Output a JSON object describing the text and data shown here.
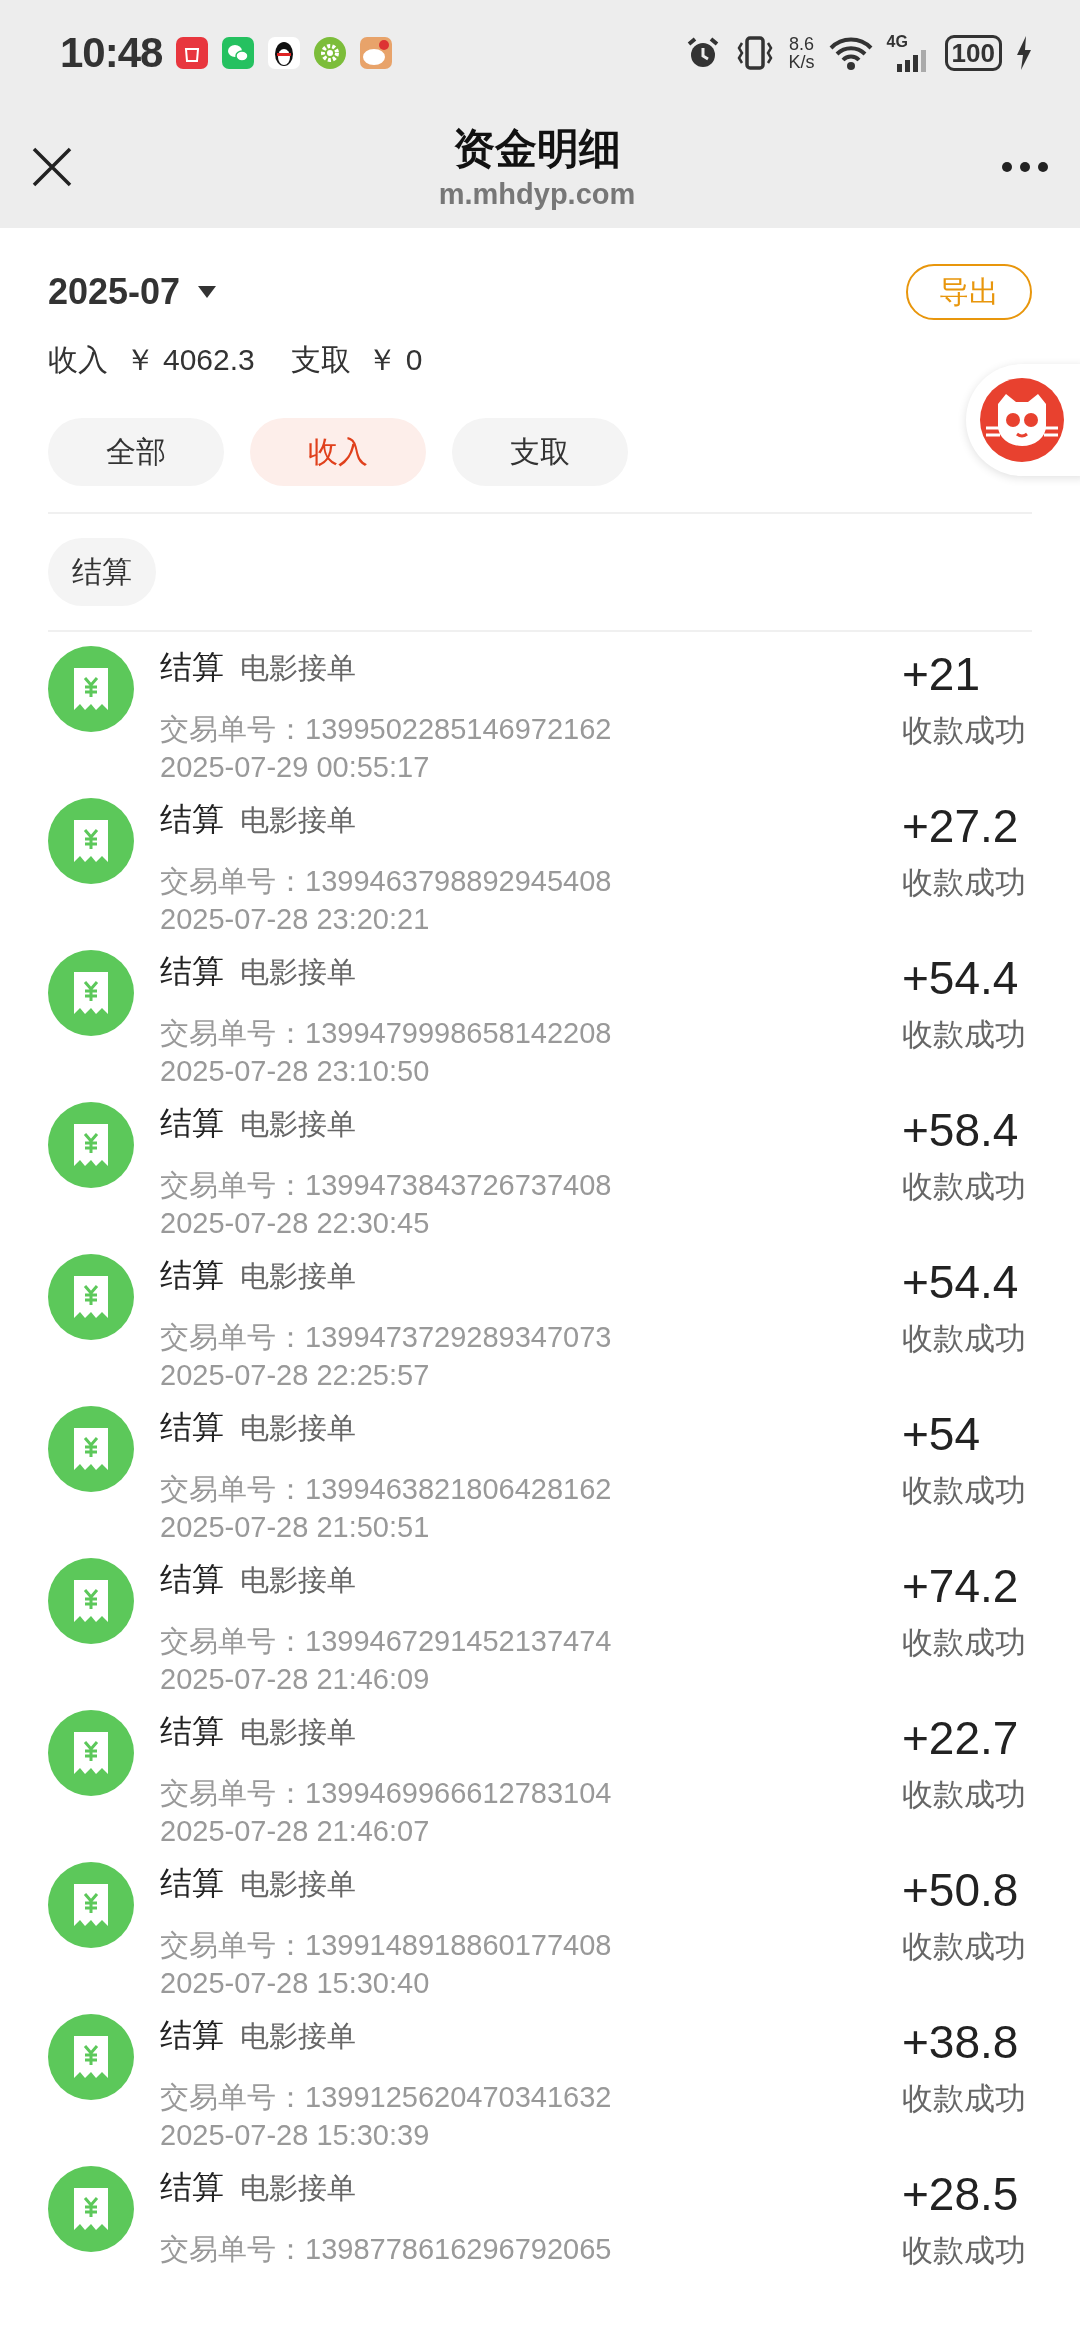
{
  "status_bar": {
    "time": "10:48",
    "net_speed": "8.6",
    "net_unit": "K/s",
    "network": "4G",
    "battery": "100"
  },
  "header": {
    "title": "资金明细",
    "url": "m.mhdyp.com"
  },
  "month": "2025-07",
  "export_button": "导出",
  "summary": [
    {
      "label": "收入",
      "amount": "￥ 4062.3"
    },
    {
      "label": "支取",
      "amount": "￥ 0"
    }
  ],
  "tabs": [
    {
      "label": "全部",
      "selected": false
    },
    {
      "label": "收入",
      "selected": true
    },
    {
      "label": "支取",
      "selected": false
    }
  ],
  "filters": [
    {
      "label": "结算"
    }
  ],
  "records": [
    {
      "category": "结算",
      "type": "电影接单",
      "order": "交易单号：1399502285146972162",
      "time": "2025-07-29 00:55:17",
      "amount": "+21",
      "status": "收款成功"
    },
    {
      "category": "结算",
      "type": "电影接单",
      "order": "交易单号：1399463798892945408",
      "time": "2025-07-28 23:20:21",
      "amount": "+27.2",
      "status": "收款成功"
    },
    {
      "category": "结算",
      "type": "电影接单",
      "order": "交易单号：1399479998658142208",
      "time": "2025-07-28 23:10:50",
      "amount": "+54.4",
      "status": "收款成功"
    },
    {
      "category": "结算",
      "type": "电影接单",
      "order": "交易单号：1399473843726737408",
      "time": "2025-07-28 22:30:45",
      "amount": "+58.4",
      "status": "收款成功"
    },
    {
      "category": "结算",
      "type": "电影接单",
      "order": "交易单号：1399473729289347073",
      "time": "2025-07-28 22:25:57",
      "amount": "+54.4",
      "status": "收款成功"
    },
    {
      "category": "结算",
      "type": "电影接单",
      "order": "交易单号：1399463821806428162",
      "time": "2025-07-28 21:50:51",
      "amount": "+54",
      "status": "收款成功"
    },
    {
      "category": "结算",
      "type": "电影接单",
      "order": "交易单号：1399467291452137474",
      "time": "2025-07-28 21:46:09",
      "amount": "+74.2",
      "status": "收款成功"
    },
    {
      "category": "结算",
      "type": "电影接单",
      "order": "交易单号：1399469966612783104",
      "time": "2025-07-28 21:46:07",
      "amount": "+22.7",
      "status": "收款成功"
    },
    {
      "category": "结算",
      "type": "电影接单",
      "order": "交易单号：1399148918860177408",
      "time": "2025-07-28 15:30:40",
      "amount": "+50.8",
      "status": "收款成功"
    },
    {
      "category": "结算",
      "type": "电影接单",
      "order": "交易单号：1399125620470341632",
      "time": "2025-07-28 15:30:39",
      "amount": "+38.8",
      "status": "收款成功"
    },
    {
      "category": "结算",
      "type": "电影接单",
      "order": "交易单号：1398778616296792065",
      "amount": "+28.5",
      "status": "收款成功"
    }
  ]
}
